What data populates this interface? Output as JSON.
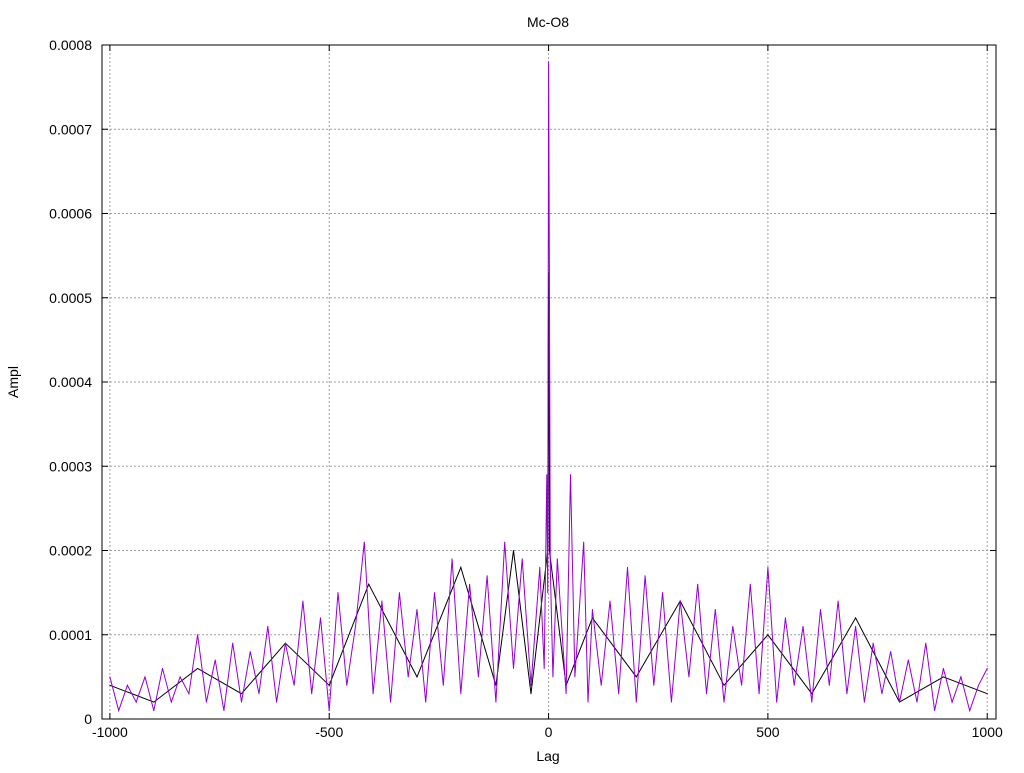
{
  "chart_data": {
    "type": "line",
    "title": "Mc-O8",
    "xlabel": "Lag",
    "ylabel": "Ampl",
    "xlim": [
      -1018,
      1020
    ],
    "ylim": [
      0,
      0.0008
    ],
    "grid": true,
    "legend": "none",
    "xticks": [
      -1000,
      -500,
      0,
      500,
      1000
    ],
    "xtick_labels": [
      "-1000",
      "-500",
      "0",
      "500",
      "1000"
    ],
    "yticks": [
      0,
      0.0001,
      0.0002,
      0.0003,
      0.0004,
      0.0005,
      0.0006,
      0.0007,
      0.0008
    ],
    "ytick_labels": [
      "0",
      "0.0001",
      "0.0002",
      "0.0003",
      "0.0004",
      "0.0005",
      "0.0006",
      "0.0007",
      "0.0008"
    ],
    "series": [
      {
        "name": "series-black",
        "color": "#000000",
        "x": [
          -1000,
          -900,
          -800,
          -700,
          -600,
          -500,
          -410,
          -300,
          -200,
          -120,
          -80,
          -40,
          -2,
          0,
          2,
          40,
          100,
          200,
          300,
          400,
          500,
          600,
          700,
          800,
          900,
          1000
        ],
        "y": [
          4e-05,
          2e-05,
          6e-05,
          3e-05,
          9e-05,
          4e-05,
          0.00016,
          5e-05,
          0.00018,
          4e-05,
          0.0002,
          3e-05,
          0.0002,
          0.00053,
          0.0002,
          4e-05,
          0.00012,
          5e-05,
          0.00014,
          4e-05,
          0.0001,
          3e-05,
          0.00012,
          2e-05,
          5e-05,
          3e-05
        ]
      },
      {
        "name": "series-purple",
        "color": "#9400d3",
        "x": [
          -1000,
          -980,
          -960,
          -940,
          -920,
          -900,
          -880,
          -860,
          -840,
          -820,
          -800,
          -780,
          -760,
          -740,
          -720,
          -700,
          -680,
          -660,
          -640,
          -620,
          -600,
          -580,
          -560,
          -540,
          -520,
          -500,
          -480,
          -460,
          -440,
          -420,
          -400,
          -380,
          -360,
          -340,
          -320,
          -300,
          -280,
          -260,
          -240,
          -220,
          -200,
          -180,
          -160,
          -140,
          -120,
          -100,
          -80,
          -60,
          -40,
          -20,
          -10,
          -4,
          -2,
          0,
          2,
          4,
          10,
          20,
          40,
          50,
          60,
          80,
          90,
          100,
          120,
          140,
          160,
          180,
          200,
          220,
          240,
          260,
          280,
          300,
          320,
          340,
          360,
          380,
          400,
          420,
          440,
          460,
          480,
          500,
          520,
          540,
          560,
          580,
          600,
          620,
          640,
          660,
          680,
          700,
          720,
          740,
          760,
          780,
          800,
          820,
          840,
          860,
          880,
          900,
          920,
          940,
          960,
          980,
          1000
        ],
        "y": [
          5e-05,
          1e-05,
          4e-05,
          2e-05,
          5e-05,
          1e-05,
          6e-05,
          2e-05,
          5e-05,
          3e-05,
          0.0001,
          2e-05,
          7e-05,
          1e-05,
          9e-05,
          2e-05,
          8e-05,
          3e-05,
          0.00011,
          2e-05,
          9e-05,
          4e-05,
          0.00014,
          3e-05,
          0.00012,
          1e-05,
          0.00015,
          4e-05,
          0.00011,
          0.00021,
          3e-05,
          0.00014,
          2e-05,
          0.00015,
          5e-05,
          0.00013,
          2e-05,
          0.00015,
          4e-05,
          0.00019,
          3e-05,
          0.00016,
          5e-05,
          0.00017,
          2e-05,
          0.00021,
          6e-05,
          0.00019,
          4e-05,
          0.00018,
          6e-05,
          0.00029,
          0.00015,
          0.00078,
          0.00053,
          0.00018,
          5e-05,
          0.00019,
          3e-05,
          0.00029,
          5e-05,
          0.00021,
          2e-05,
          0.00013,
          4e-05,
          0.00014,
          3e-05,
          0.00018,
          2e-05,
          0.00017,
          4e-05,
          0.00015,
          2e-05,
          0.00014,
          5e-05,
          0.00016,
          3e-05,
          0.00013,
          2e-05,
          0.00011,
          4e-05,
          0.00016,
          3e-05,
          0.00018,
          2e-05,
          0.00012,
          4e-05,
          0.00011,
          2e-05,
          0.00013,
          4e-05,
          0.00014,
          3e-05,
          0.00011,
          2e-05,
          9e-05,
          3e-05,
          8e-05,
          2e-05,
          7e-05,
          2e-05,
          9e-05,
          1e-05,
          6e-05,
          2e-05,
          5e-05,
          1e-05,
          4e-05,
          6e-05
        ]
      }
    ]
  }
}
